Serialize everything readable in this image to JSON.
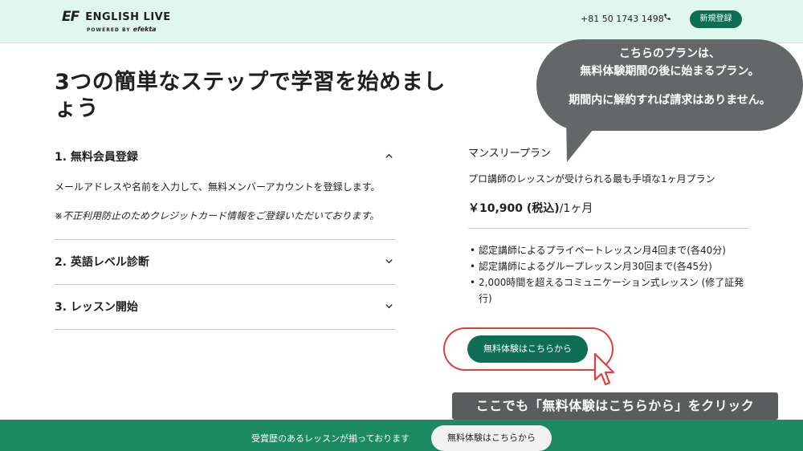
{
  "header": {
    "logo_mark": "EF",
    "brand_name": "ENGLISH LIVE",
    "powered_by": "POWERED BY",
    "powered_brand": "efekta",
    "phone": "+81 50 1743 1498",
    "phone_icon": "phone-icon",
    "signup_label": "新規登録"
  },
  "main": {
    "title": "3つの簡単なステップで学習を始めましょう",
    "steps": [
      {
        "label": "1. 無料会員登録",
        "expanded": true,
        "description": "メールアドレスや名前を入力して、無料メンバーアカウントを登録します。",
        "note": "※不正利用防止のためクレジットカード情報をご登録いただいております。"
      },
      {
        "label": "2. 英語レベル診断",
        "expanded": false
      },
      {
        "label": "3. レッスン開始",
        "expanded": false
      }
    ]
  },
  "plan": {
    "name": "マンスリープラン",
    "description": "プロ講師のレッスンが受けられる最も手頃な1ヶ月プラン",
    "price": "￥10,900 (税込)",
    "price_period": "/1ヶ月",
    "features": [
      "認定講師によるプライベートレッスン月4回まで(各40分)",
      "認定講師によるグループレッスン月30回まで(各45分)",
      "2,000時間を超えるコミュニケーション式レッスン (修了証発行)"
    ],
    "trial_button": "無料体験はこちらから"
  },
  "annotation": {
    "bubble_line1": "こちらのプランは、",
    "bubble_line2": "無料体験期間の後に始まるプラン。",
    "bubble_line3": "期間内に解約すれば請求はありません。",
    "caption": "ここでも「無料体験はこちらから」をクリック"
  },
  "footer": {
    "text": "受賞歴のあるレッスンが揃っております",
    "button": "無料体験はこちらから"
  },
  "colors": {
    "header_bg": "#e0f7ef",
    "brand_green": "#0e6e54",
    "footer_green": "#1c8a63",
    "highlight_red": "#e0403a",
    "annotation_gray": "#646768"
  }
}
